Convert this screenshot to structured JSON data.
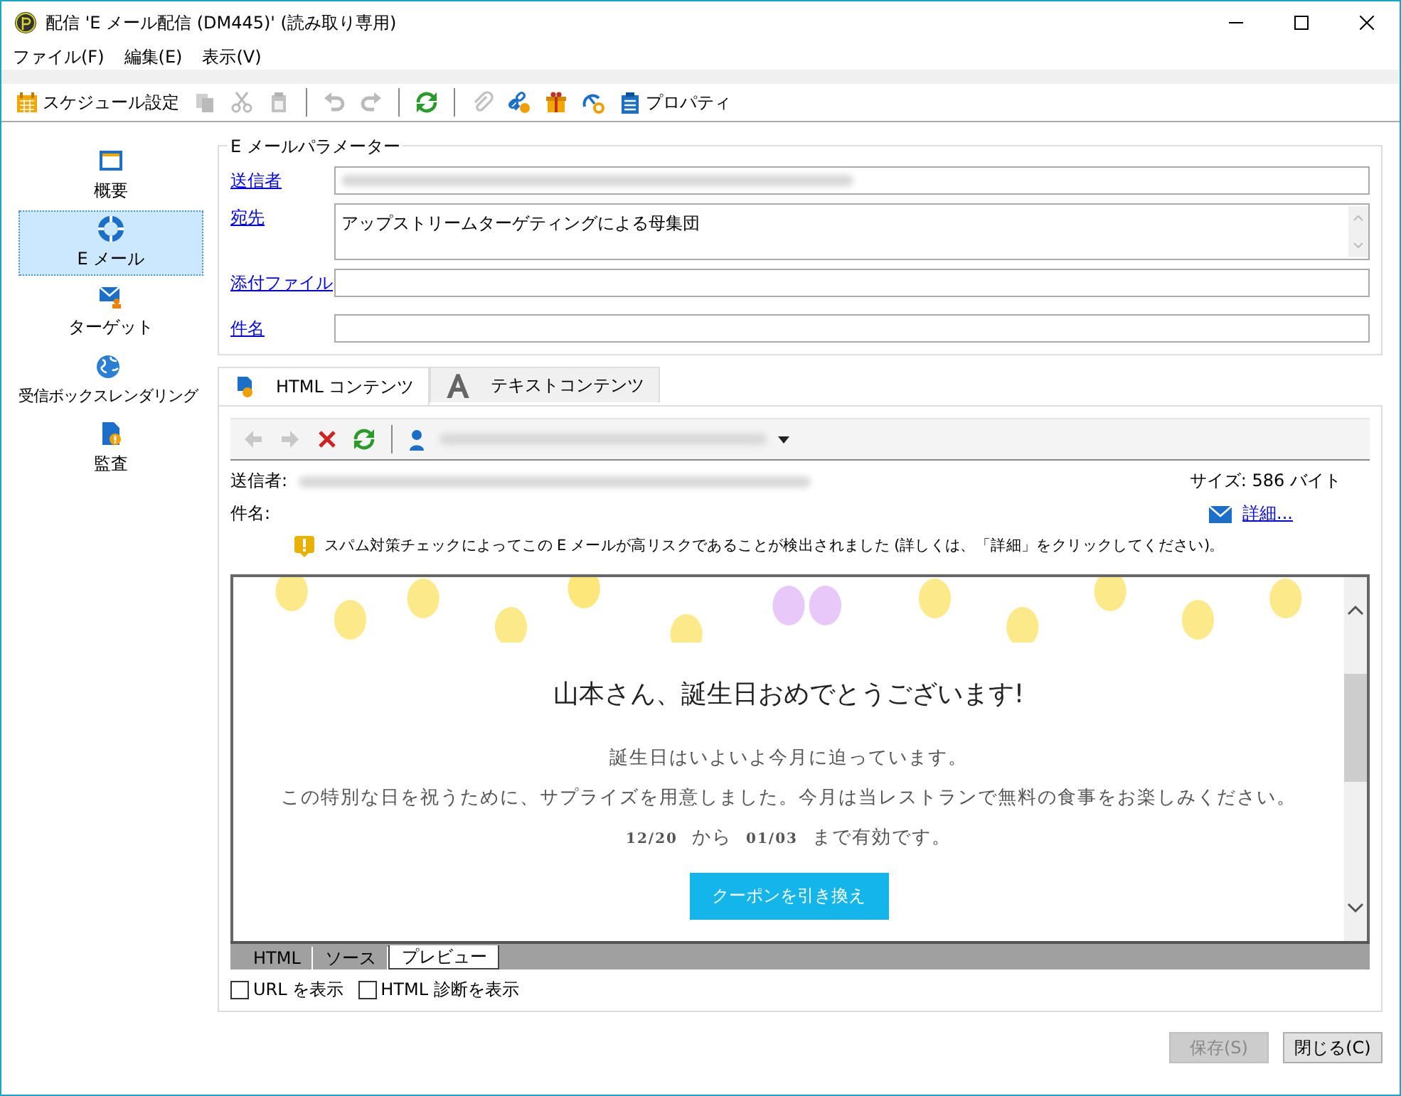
{
  "window": {
    "title": "配信 'E メール配信 (DM445)' (読み取り専用)"
  },
  "menu": [
    "ファイル(F)",
    "編集(E)",
    "表示(V)"
  ],
  "toolbar": [
    {
      "kind": "labeled",
      "label": "スケジュール設定",
      "disabled": false
    },
    {
      "kind": "icon",
      "disabled": true
    },
    {
      "kind": "icon",
      "disabled": true
    },
    {
      "kind": "icon",
      "disabled": true
    },
    {
      "kind": "separator"
    },
    {
      "kind": "icon",
      "disabled": true
    },
    {
      "kind": "icon",
      "disabled": true
    },
    {
      "kind": "separator"
    },
    {
      "kind": "icon",
      "disabled": false
    },
    {
      "kind": "separator"
    },
    {
      "kind": "icon",
      "disabled": true
    },
    {
      "kind": "icon",
      "disabled": false
    },
    {
      "kind": "icon",
      "disabled": false
    },
    {
      "kind": "icon",
      "disabled": false
    },
    {
      "kind": "labeled",
      "label": "プロパティ",
      "disabled": false
    }
  ],
  "sidebar": {
    "items": [
      {
        "label": "概要",
        "selected": false
      },
      {
        "label": "E メール",
        "selected": true
      },
      {
        "label": "ターゲット",
        "selected": false
      },
      {
        "label": "受信ボックスレンダリング",
        "selected": false
      },
      {
        "label": "監査",
        "selected": false
      }
    ]
  },
  "email_parameters": {
    "title": "E メールパラメーター",
    "fields": [
      {
        "label": "送信者",
        "kind": "single",
        "blurred": true
      },
      {
        "label": "宛先",
        "kind": "multi",
        "value": "アップストリームターゲティングによる母集団"
      },
      {
        "label": "添付ファイル",
        "kind": "single"
      },
      {
        "label": "件名",
        "kind": "single"
      }
    ]
  },
  "content_tabs": [
    {
      "label": "HTML コンテンツ",
      "selected": true
    },
    {
      "label": "テキストコンテンツ",
      "selected": false
    }
  ],
  "preview_toolbar": [
    {
      "kind": "icon",
      "disabled": true
    },
    {
      "kind": "icon",
      "disabled": true
    },
    {
      "kind": "icon",
      "disabled": false
    },
    {
      "kind": "icon",
      "disabled": false
    },
    {
      "kind": "separator"
    },
    {
      "kind": "recipient"
    }
  ],
  "info": {
    "sender_label": "送信者:",
    "subject_label": "件名:",
    "size": "サイズ: 586 バイト",
    "details_link": "詳細...",
    "warning": "スパム対策チェックによってこの E メールが高リスクであることが検出されました (詳しくは、「詳細」をクリックしてください)。"
  },
  "email": {
    "heading": "山本さん、誕生日おめでとうございます!",
    "line_1": "誕生日はいよいよ今月に迫っています。",
    "line_2": "この特別な日を祝うために、サプライズを用意しました。今月は当レストランで無料の食事をお楽しみください。",
    "validity": [
      "12/20",
      "から",
      "01/03",
      "まで有効です。"
    ],
    "button": "クーポンを引き換え"
  },
  "view_tabs": [
    {
      "label": "HTML",
      "selected": false
    },
    {
      "label": "ソース",
      "selected": false
    },
    {
      "label": "プレビュー",
      "selected": true
    }
  ],
  "options": [
    {
      "label": "URL を表示",
      "checked": false
    },
    {
      "label": "HTML 診断を表示",
      "checked": false
    }
  ],
  "buttons": [
    {
      "label": "保存(S)",
      "disabled": true
    },
    {
      "label": "閉じる(C)",
      "disabled": false
    }
  ]
}
